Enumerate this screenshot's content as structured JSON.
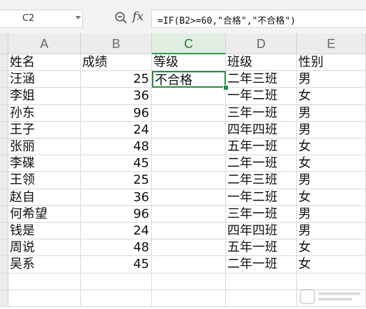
{
  "formula_bar": {
    "name_box": "C2",
    "formula": "=IF(B2>=60,\"合格\",\"不合格\")"
  },
  "columns": [
    "A",
    "B",
    "C",
    "D",
    "E"
  ],
  "active_column": "C",
  "headers": [
    "姓名",
    "成绩",
    "等级",
    "班级",
    "性别"
  ],
  "rows": [
    {
      "name": "汪涵",
      "score": "25",
      "grade": "不合格",
      "class": "二年三班",
      "gender": "男"
    },
    {
      "name": "李姐",
      "score": "36",
      "grade": "",
      "class": "一年二班",
      "gender": "女"
    },
    {
      "name": "孙东",
      "score": "96",
      "grade": "",
      "class": "三年一班",
      "gender": "男"
    },
    {
      "name": "王子",
      "score": "24",
      "grade": "",
      "class": "四年四班",
      "gender": "男"
    },
    {
      "name": "张丽",
      "score": "48",
      "grade": "",
      "class": "五年一班",
      "gender": "女"
    },
    {
      "name": "李碟",
      "score": "45",
      "grade": "",
      "class": "二年一班",
      "gender": "女"
    },
    {
      "name": "王领",
      "score": "25",
      "grade": "",
      "class": "二年三班",
      "gender": "男"
    },
    {
      "name": "赵自",
      "score": "36",
      "grade": "",
      "class": "一年二班",
      "gender": "女"
    },
    {
      "name": "何希望",
      "score": "96",
      "grade": "",
      "class": "三年一班",
      "gender": "男"
    },
    {
      "name": "钱是",
      "score": "24",
      "grade": "",
      "class": "四年四班",
      "gender": "男"
    },
    {
      "name": "周说",
      "score": "48",
      "grade": "",
      "class": "五年一班",
      "gender": "女"
    },
    {
      "name": "吴系",
      "score": "45",
      "grade": "",
      "class": "二年一班",
      "gender": "女"
    }
  ],
  "colors": {
    "selection": "#2a8a44",
    "active_header_bg": "#e1efe2",
    "header_bg": "#ececec",
    "gridline": "#d9d9d9"
  },
  "icons": [
    "zoom-formula-icon",
    "fx-icon",
    "dropdown-caret-icon"
  ]
}
